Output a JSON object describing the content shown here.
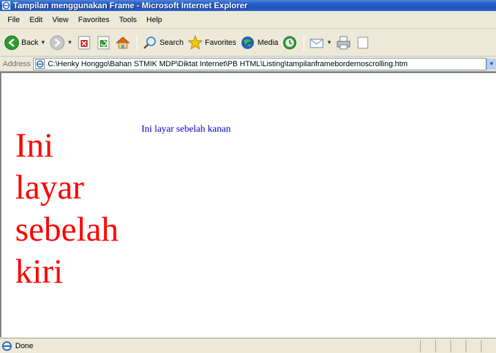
{
  "window": {
    "title": "Tampilan menggunakan Frame - Microsoft Internet Explorer"
  },
  "menu": {
    "items": [
      "File",
      "Edit",
      "View",
      "Favorites",
      "Tools",
      "Help"
    ]
  },
  "toolbar": {
    "back_label": "Back",
    "search_label": "Search",
    "favorites_label": "Favorites",
    "media_label": "Media"
  },
  "address": {
    "label": "Address",
    "value": "C:\\Henky Honggo\\Bahan STMIK MDP\\Diktat Internet\\PB HTML\\Listing\\tampilanframebordernoscrolling.htm"
  },
  "frames": {
    "left": {
      "words": [
        "Ini",
        "layar",
        "sebelah",
        "kiri"
      ],
      "color": "#ff0000"
    },
    "right": {
      "text": "Ini layar sebelah kanan",
      "color": "#0000cc"
    }
  },
  "status": {
    "text": "Done"
  },
  "icons": {
    "title": "ie-logo-icon",
    "back": "back-arrow-icon",
    "forward": "forward-arrow-icon",
    "stop": "stop-icon",
    "refresh": "refresh-icon",
    "home": "home-icon",
    "search": "search-icon",
    "favorites": "favorites-star-icon",
    "media": "media-icon",
    "history": "history-icon",
    "mail": "mail-icon",
    "print": "print-icon"
  }
}
